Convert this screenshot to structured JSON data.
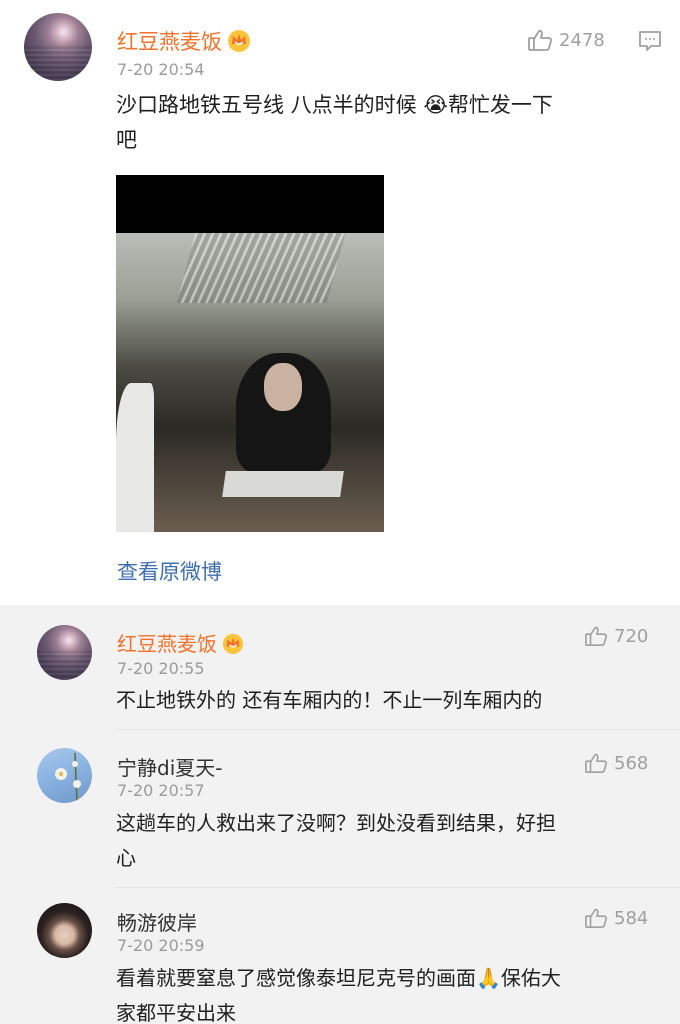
{
  "post": {
    "author": "红豆燕麦饭",
    "time": "7-20 20:54",
    "likes": "2478",
    "text_line1": "沙口路地铁五号线 八点半的时候",
    "emoji": "😭",
    "text_line1b": "帮忙发一下",
    "text_line2": "吧",
    "view_original": "查看原微博"
  },
  "comments": [
    {
      "author": "红豆燕麦饭",
      "time": "7-20 20:55",
      "likes": "720",
      "text": "不止地铁外的 还有车厢内的！不止一列车厢内的"
    },
    {
      "author": "宁静di夏天-",
      "time": "7-20 20:57",
      "likes": "568",
      "text_line1": "这趟车的人救出来了没啊？到处没看到结果，好担",
      "text_line2": "心"
    },
    {
      "author": "畅游彼岸",
      "time": "7-20 20:59",
      "likes": "584",
      "text_line1": "看着就要窒息了感觉像泰坦尼克号的画面",
      "emoji": "🙏",
      "text_line1b": "保佑大",
      "text_line2": "家都平安出来"
    }
  ],
  "icons": {
    "like": "thumbs-up-icon",
    "comment": "comment-icon",
    "crown": "crown-badge-icon"
  },
  "colors": {
    "author_orange": "#f0722b",
    "link_blue": "#3f6fb0",
    "comments_bg": "#f2f2f2"
  }
}
